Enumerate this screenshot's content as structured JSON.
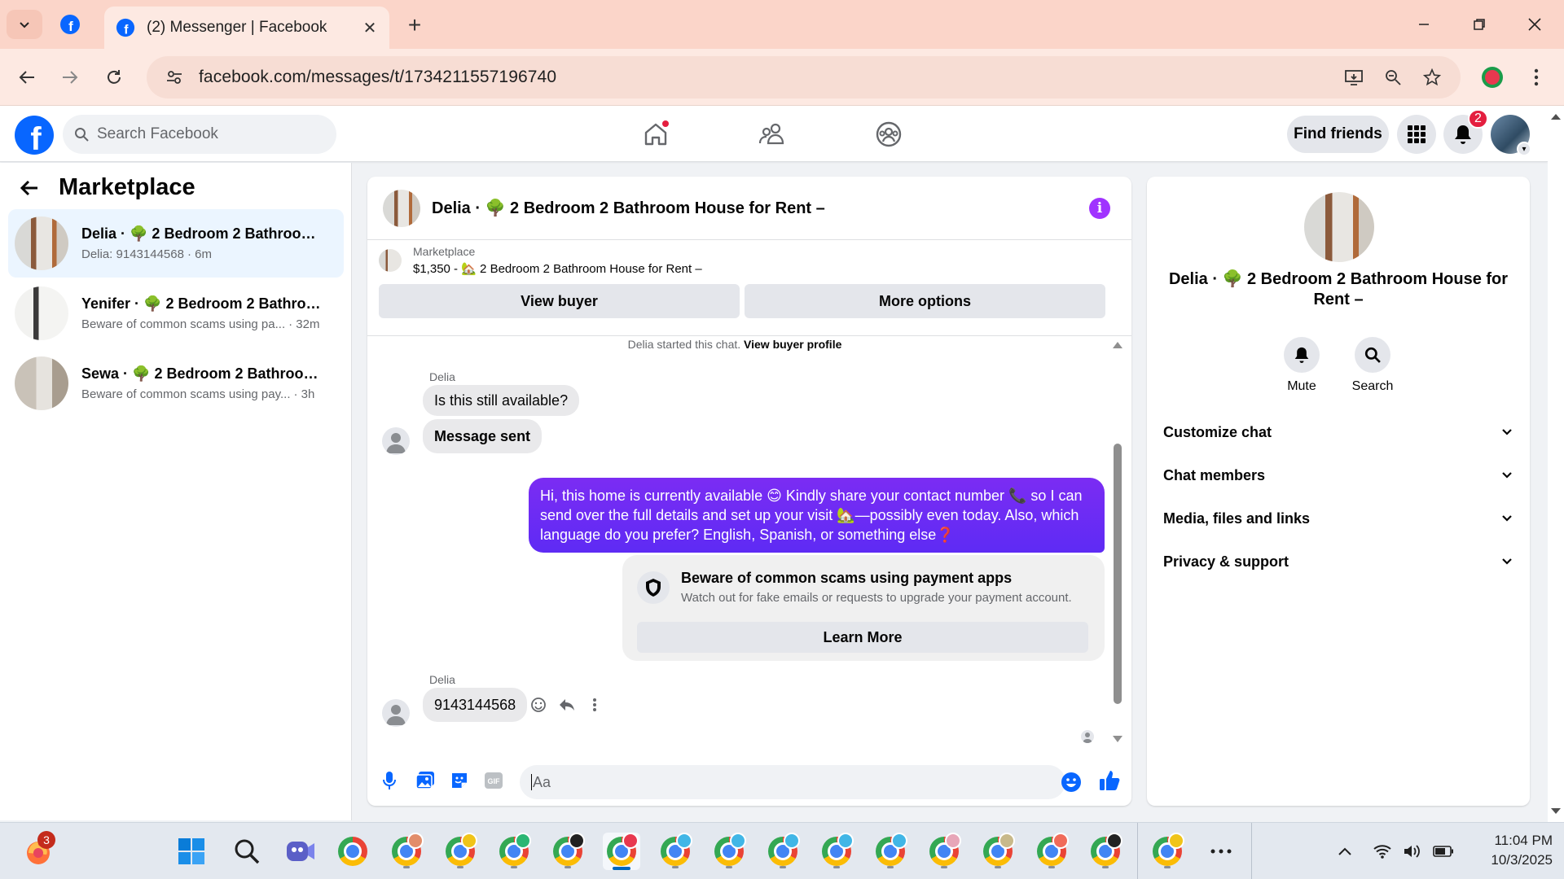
{
  "browser": {
    "pinned_tab_icon": "facebook-icon",
    "active_tab_title": "(2) Messenger | Facebook",
    "url": "facebook.com/messages/t/1734211557196740"
  },
  "fb_header": {
    "logo_letter": "f",
    "search_placeholder": "Search Facebook",
    "find_friends_label": "Find friends",
    "notification_count": "2"
  },
  "sidebar": {
    "title": "Marketplace",
    "conversations": [
      {
        "name": "Delia · 🌳 2 Bedroom 2 Bathroom ...",
        "snippet": "Delia: 9143144568",
        "time": "· 6m",
        "active": true
      },
      {
        "name": "Yenifer · 🌳 2 Bedroom 2 Bathroo...",
        "snippet": "Beware of common scams using pa...",
        "time": "· 32m",
        "active": false
      },
      {
        "name": "Sewa · 🌳 2 Bedroom 2 Bathroom ...",
        "snippet": "Beware of common scams using pay...",
        "time": "· 3h",
        "active": false
      }
    ]
  },
  "chat": {
    "title": "Delia · 🌳 2 Bedroom 2 Bathroom House for Rent –",
    "listing_label": "Marketplace",
    "listing_desc": "$1,350 - 🏡 2 Bedroom 2 Bathroom House for Rent –",
    "view_buyer_label": "View buyer",
    "more_options_label": "More options",
    "started_text": "Delia started this chat.",
    "view_buyer_profile_label": "View buyer profile",
    "messages": {
      "sender_name": "Delia",
      "in_1": "Is this still available?",
      "in_2": "Message sent",
      "out_1": "Hi, this home is currently available 😊 Kindly share your contact number 📞 so I can send over the full details and set up your visit 🏡—possibly even today. Also, which language do you prefer? English, Spanish, or something else❓",
      "in_3": "9143144568"
    },
    "scam_notice": {
      "title": "Beware of common scams using payment apps",
      "body": "Watch out for fake emails or requests to upgrade your payment account.",
      "button": "Learn More"
    },
    "composer_placeholder": "Aa"
  },
  "right_panel": {
    "name": "Delia · 🌳 2 Bedroom 2 Bathroom House for Rent –",
    "actions": [
      {
        "label": "Mute",
        "icon": "bell-icon"
      },
      {
        "label": "Search",
        "icon": "search-icon"
      }
    ],
    "sections": [
      "Customize chat",
      "Chat members",
      "Media, files and links",
      "Privacy & support"
    ]
  },
  "taskbar": {
    "firefox_badge": "3",
    "clock_time": "11:04 PM",
    "clock_date": "10/3/2025"
  },
  "colors": {
    "facebook_blue": "#0866ff",
    "outgoing_bubble": "#5e2bf4",
    "info_purple": "#a033ff",
    "badge_red": "#e41e3f",
    "tabstrip_bg": "#fbd5c9"
  }
}
